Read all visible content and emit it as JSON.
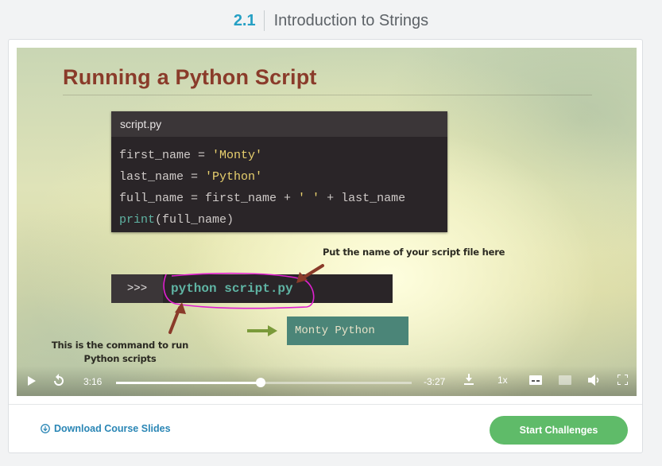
{
  "header": {
    "section_number": "2.1",
    "section_title": "Introduction to Strings"
  },
  "video": {
    "slide_title": "Running a Python Script",
    "code_file_name": "script.py",
    "code_lines": [
      {
        "var": "first_name",
        "op": " = ",
        "str": "'Monty'"
      },
      {
        "var": "last_name",
        "op": " = ",
        "str": "'Python'"
      },
      {
        "full": "full_name = first_name + ' ' + last_name"
      },
      {
        "kw": "print",
        "rest": "(full_name)"
      }
    ],
    "line3_parts": [
      "full_name = first_name + ",
      "' '",
      " + last_name"
    ],
    "cmd_prompt": ">>>",
    "cmd_text": "python script.py",
    "output_text": "Monty Python",
    "annotation_script_file": "Put the name of your script file here",
    "annotation_command": "This is the command to run Python scripts",
    "colors": {
      "arrow_brown": "#8a3b2a",
      "arrow_green": "#7a9a3a",
      "circle_magenta": "#e020d0"
    },
    "controls": {
      "elapsed": "3:16",
      "remaining": "-3:27",
      "speed": "1x",
      "progress": 0.49,
      "icons": [
        "play-icon",
        "replay-icon",
        "download-icon",
        "captions-icon",
        "hd-icon",
        "volume-icon",
        "fullscreen-icon"
      ]
    }
  },
  "footer": {
    "download_label": "Download Course Slides",
    "start_label": "Start Challenges"
  }
}
